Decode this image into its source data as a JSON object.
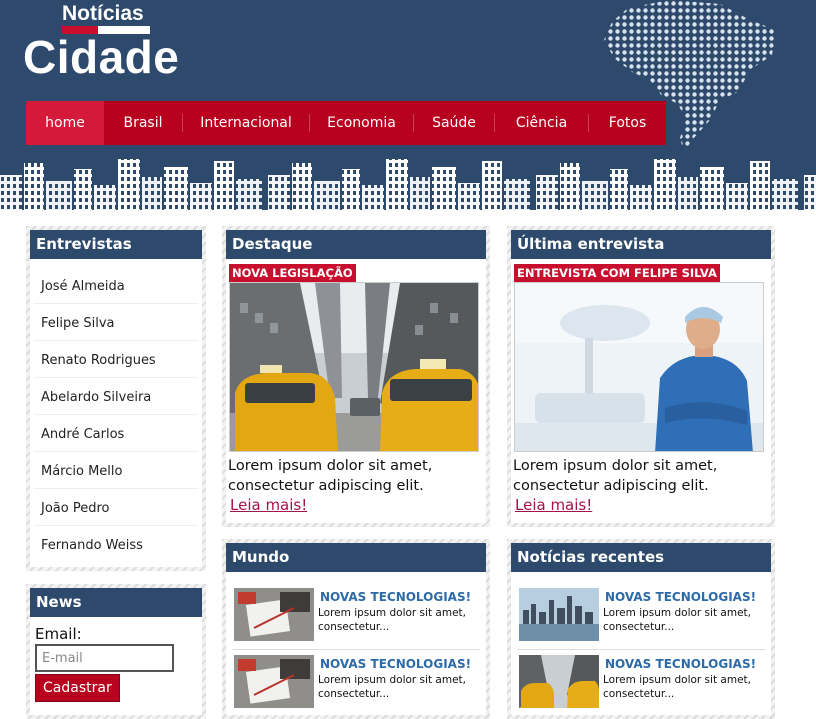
{
  "brand": {
    "top": "Notícias",
    "main": "Cidade"
  },
  "nav": [
    {
      "label": "home",
      "active": true
    },
    {
      "label": "Brasil"
    },
    {
      "label": "Internacional"
    },
    {
      "label": "Economia"
    },
    {
      "label": "Saúde"
    },
    {
      "label": "Ciência"
    },
    {
      "label": "Fotos"
    }
  ],
  "interviews": {
    "title": "Entrevistas",
    "items": [
      "José Almeida",
      "Felipe Silva",
      "Renato Rodrigues",
      "Abelardo Silveira",
      "André Carlos",
      "Márcio Mello",
      "João Pedro",
      "Fernando Weiss"
    ]
  },
  "news_form": {
    "title": "News",
    "email_label": "Email:",
    "email_placeholder": "E-mail",
    "submit_label": "Cadastrar"
  },
  "highlight": {
    "title": "Destaque",
    "tag": "NOVA LEGISLAÇÃO",
    "text": "Lorem ipsum dolor sit amet, consectetur adipiscing elit.",
    "link": "Leia mais!"
  },
  "last_interview": {
    "title": "Última entrevista",
    "tag": "ENTREVISTA COM FELIPE SILVA",
    "text": "Lorem ipsum dolor sit amet, consectetur adipiscing elit.",
    "link": "Leia mais!"
  },
  "world": {
    "title": "Mundo",
    "items": [
      {
        "headline": "NOVAS TECNOLOGIAS!",
        "text": "Lorem ipsum dolor sit amet, consectetur..."
      },
      {
        "headline": "NOVAS TECNOLOGIAS!",
        "text": "Lorem ipsum dolor sit amet, consectetur..."
      }
    ]
  },
  "recent": {
    "title": "Notícias recentes",
    "items": [
      {
        "headline": "NOVAS TECNOLOGIAS!",
        "text": "Lorem ipsum dolor sit amet, consectetur..."
      },
      {
        "headline": "NOVAS TECNOLOGIAS!",
        "text": "Lorem ipsum dolor sit amet, consectetur..."
      }
    ]
  },
  "colors": {
    "navy": "#2d4a6d",
    "red": "#b8001f",
    "link": "#a4124a",
    "headline_blue": "#2d6aa8"
  }
}
